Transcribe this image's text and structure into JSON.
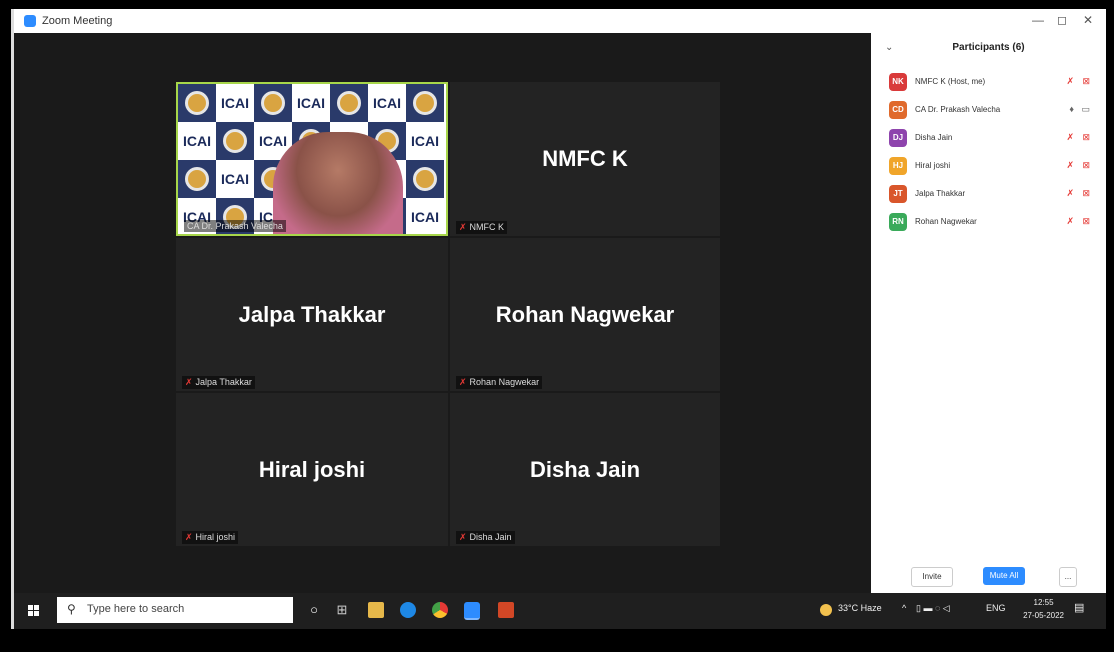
{
  "window": {
    "title": "Zoom Meeting",
    "controls": [
      "—",
      "◻",
      "✕"
    ]
  },
  "gallery": {
    "video_tile": {
      "label": "CA Dr. Prakash Valecha",
      "pattern_text": "ICAI"
    },
    "tiles": [
      {
        "name": "NMFC K",
        "label": "NMFC K"
      },
      {
        "name": "Jalpa Thakkar",
        "label": "Jalpa Thakkar"
      },
      {
        "name": "Rohan Nagwekar",
        "label": "Rohan Nagwekar"
      },
      {
        "name": "Hiral joshi",
        "label": "Hiral joshi"
      },
      {
        "name": "Disha Jain",
        "label": "Disha Jain"
      }
    ]
  },
  "participants": {
    "title": "Participants (6)",
    "list": [
      {
        "initials": "NK",
        "name": "NMFC K (Host, me)",
        "color": "#d93a3a"
      },
      {
        "initials": "CD",
        "name": "CA Dr. Prakash Valecha",
        "color": "#e06a2c"
      },
      {
        "initials": "DJ",
        "name": "Disha Jain",
        "color": "#8e44ad"
      },
      {
        "initials": "HJ",
        "name": "Hiral joshi",
        "color": "#f0a52a"
      },
      {
        "initials": "JT",
        "name": "Jalpa Thakkar",
        "color": "#d9562b"
      },
      {
        "initials": "RN",
        "name": "Rohan Nagwekar",
        "color": "#3aaa5a"
      }
    ],
    "invite_label": "Invite",
    "mute_all_label": "Mute All",
    "more_label": "..."
  },
  "taskbar": {
    "search_placeholder": "Type here to search",
    "weather": "33°C Haze",
    "language": "ENG",
    "time": "12:55",
    "date": "27-05-2022"
  },
  "colors": {
    "accent": "#2d8cff",
    "active_speaker_border": "#a7d64a",
    "muted_red": "#e53935"
  }
}
